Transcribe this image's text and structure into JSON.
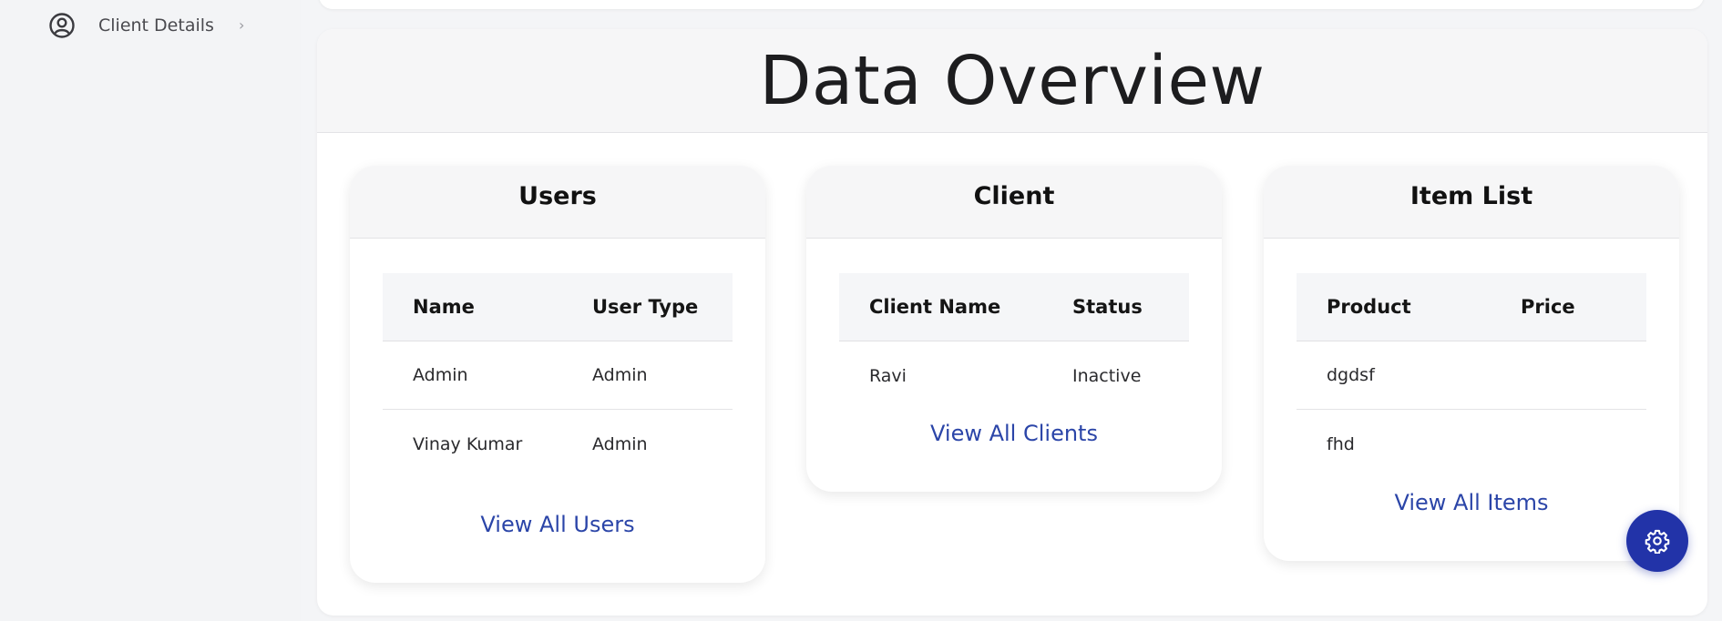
{
  "sidebar": {
    "items": [
      {
        "label": "Client Details",
        "icon": "user-circle-icon",
        "chevron": "›"
      }
    ]
  },
  "overview": {
    "title": "Data Overview"
  },
  "users_card": {
    "title": "Users",
    "columns": [
      "Name",
      "User Type"
    ],
    "rows": [
      [
        "Admin",
        "Admin"
      ],
      [
        "Vinay Kumar",
        "Admin"
      ]
    ],
    "link_label": "View All Users"
  },
  "client_card": {
    "title": "Client",
    "columns": [
      "Client Name",
      "Status"
    ],
    "rows": [
      [
        "Ravi",
        "Inactive"
      ]
    ],
    "link_label": "View All Clients"
  },
  "items_card": {
    "title": "Item List",
    "columns": [
      "Product",
      "Price"
    ],
    "rows": [
      [
        "dgdsf",
        ""
      ],
      [
        "fhd",
        ""
      ]
    ],
    "link_label": "View All Items"
  },
  "fab": {
    "icon": "gear-icon"
  },
  "colors": {
    "accent": "#2233a8",
    "link": "#2b45a8",
    "sidebar_bg": "#f3f4f6",
    "card_header_bg": "#f6f6f7"
  }
}
